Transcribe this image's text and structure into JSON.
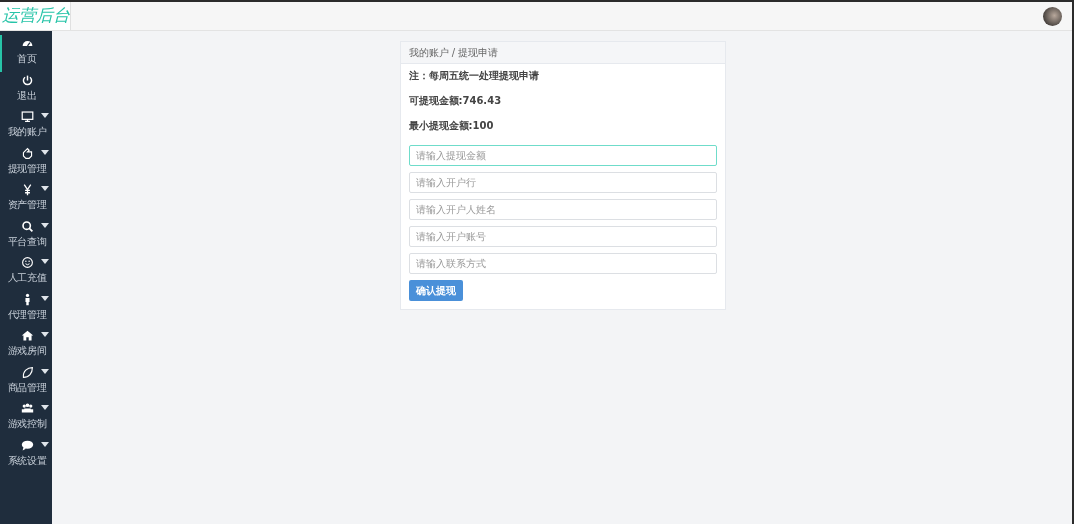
{
  "header": {
    "logo": "运营后台"
  },
  "sidebar": {
    "items": [
      {
        "label": "首页",
        "selected": true,
        "expandable": false
      },
      {
        "label": "退出",
        "selected": false,
        "expandable": false
      },
      {
        "label": "我的账户",
        "selected": false,
        "expandable": true
      },
      {
        "label": "提现管理",
        "selected": false,
        "expandable": true
      },
      {
        "label": "资产管理",
        "selected": false,
        "expandable": true
      },
      {
        "label": "平台查询",
        "selected": false,
        "expandable": true
      },
      {
        "label": "人工充值",
        "selected": false,
        "expandable": true
      },
      {
        "label": "代理管理",
        "selected": false,
        "expandable": true
      },
      {
        "label": "游戏房间",
        "selected": false,
        "expandable": true
      },
      {
        "label": "商品管理",
        "selected": false,
        "expandable": true
      },
      {
        "label": "游戏控制",
        "selected": false,
        "expandable": true
      },
      {
        "label": "系统设置",
        "selected": false,
        "expandable": true
      }
    ]
  },
  "card": {
    "breadcrumb": "我的账户 / 提现申请",
    "notes": [
      "注：每周五统一处理提现申请",
      "可提现金额:746.43",
      "最小提现金额:100"
    ],
    "fields": [
      {
        "placeholder": "请输入提现金额",
        "focused": true
      },
      {
        "placeholder": "请输入开户行",
        "focused": false
      },
      {
        "placeholder": "请输入开户人姓名",
        "focused": false
      },
      {
        "placeholder": "请输入开户账号",
        "focused": false
      },
      {
        "placeholder": "请输入联系方式",
        "focused": false
      }
    ],
    "submit": "确认提现"
  }
}
